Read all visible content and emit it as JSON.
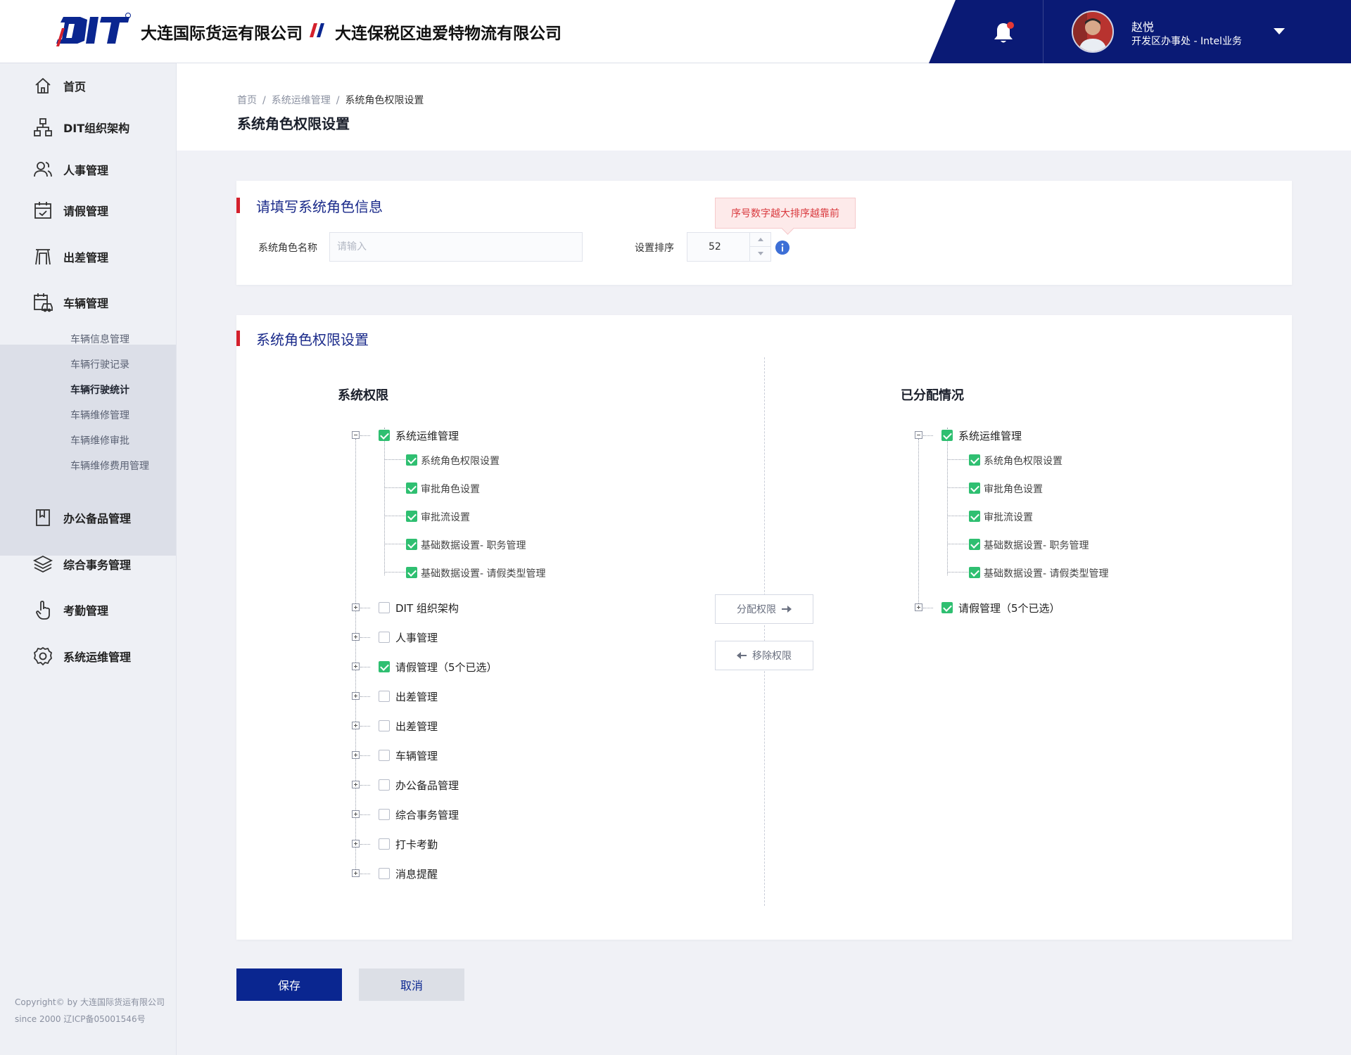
{
  "header": {
    "company1": "大连国际货运有限公司",
    "company2": "大连保税区迪爱特物流有限公司",
    "user_name": "赵悦",
    "user_dept": "开发区办事处 - Intel业务"
  },
  "colors": {
    "brand_dark": "#0a1a75",
    "accent_red": "#d4202c",
    "check_green": "#2fbf71",
    "primary_button": "#0a2690"
  },
  "sidebar": {
    "items": [
      {
        "label": "首页",
        "icon": "home-icon"
      },
      {
        "label": "DIT组织架构",
        "icon": "org-chart-icon"
      },
      {
        "label": "人事管理",
        "icon": "people-icon"
      },
      {
        "label": "请假管理",
        "icon": "calendar-check-icon"
      },
      {
        "label": "出差管理",
        "icon": "travel-gate-icon"
      },
      {
        "label": "车辆管理",
        "icon": "vehicle-icon"
      },
      {
        "label": "办公备品管理",
        "icon": "bookmark-icon"
      },
      {
        "label": "综合事务管理",
        "icon": "layers-icon"
      },
      {
        "label": "考勤管理",
        "icon": "touch-hand-icon"
      },
      {
        "label": "系统运维管理",
        "icon": "gear-icon"
      }
    ],
    "vehicle_sub": [
      {
        "label": "车辆信息管理",
        "active": false
      },
      {
        "label": "车辆行驶记录",
        "active": false
      },
      {
        "label": "车辆行驶统计",
        "active": true
      },
      {
        "label": "车辆维修管理",
        "active": false
      },
      {
        "label": "车辆维修审批",
        "active": false
      },
      {
        "label": "车辆维修费用管理",
        "active": false
      }
    ],
    "copyright_line1": "Copyright© by 大连国际货运有限公司",
    "copyright_line2": "since 2000 辽ICP备05001546号"
  },
  "page": {
    "breadcrumb": [
      "首页",
      "系统运维管理",
      "系统角色权限设置"
    ],
    "title": "系统角色权限设置"
  },
  "role_info": {
    "section_title": "请填写系统角色信息",
    "name_label": "系统角色名称",
    "name_placeholder": "请输入",
    "sort_label": "设置排序",
    "sort_value": "52",
    "tooltip": "序号数字越大排序越靠前"
  },
  "permissions": {
    "section_title": "系统角色权限设置",
    "left_title": "系统权限",
    "right_title": "已分配情况",
    "assign_button": "分配权限",
    "remove_button": "移除权限",
    "left_tree": [
      {
        "label": "系统运维管理",
        "checked": true,
        "expanded": true,
        "children": [
          {
            "label": "系统角色权限设置",
            "checked": true
          },
          {
            "label": "审批角色设置",
            "checked": true
          },
          {
            "label": "审批流设置",
            "checked": true
          },
          {
            "label": "基础数据设置- 职务管理",
            "checked": true
          },
          {
            "label": "基础数据设置- 请假类型管理",
            "checked": true
          }
        ]
      },
      {
        "label": "DIT 组织架构",
        "checked": false
      },
      {
        "label": "人事管理",
        "checked": false
      },
      {
        "label": "请假管理（5个已选）",
        "checked": true
      },
      {
        "label": "出差管理",
        "checked": false
      },
      {
        "label": "出差管理",
        "checked": false
      },
      {
        "label": "车辆管理",
        "checked": false
      },
      {
        "label": "办公备品管理",
        "checked": false
      },
      {
        "label": "综合事务管理",
        "checked": false
      },
      {
        "label": "打卡考勤",
        "checked": false
      },
      {
        "label": "消息提醒",
        "checked": false
      }
    ],
    "right_tree": [
      {
        "label": "系统运维管理",
        "checked": true,
        "expanded": true,
        "children": [
          {
            "label": "系统角色权限设置",
            "checked": true
          },
          {
            "label": "审批角色设置",
            "checked": true
          },
          {
            "label": "审批流设置",
            "checked": true
          },
          {
            "label": "基础数据设置- 职务管理",
            "checked": true
          },
          {
            "label": "基础数据设置- 请假类型管理",
            "checked": true
          }
        ]
      },
      {
        "label": "请假管理（5个已选）",
        "checked": true
      }
    ]
  },
  "actions": {
    "save": "保存",
    "cancel": "取消"
  }
}
